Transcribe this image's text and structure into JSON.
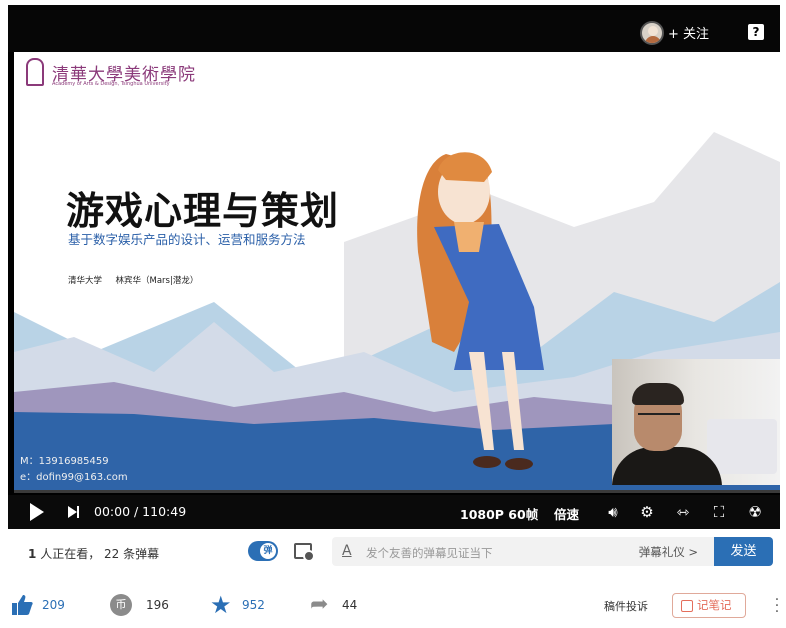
{
  "header": {
    "follow_label": "+ 关注",
    "help_label": "?"
  },
  "slide": {
    "logo_text": "清華大學美術學院",
    "logo_sub": "Academy of Arts & Design, Tsinghua University",
    "title": "游戏心理与策划",
    "subtitle": "基于数字娱乐产品的设计、运营和服务方法",
    "authors": "清华大学     林宾华（Mars|潜龙）",
    "contact_phone": "M：13916985459",
    "contact_email": "e：dofin99@163.com"
  },
  "controls": {
    "time": "00:00 / 110:49",
    "quality": "1080P 60帧",
    "speed": "倍速"
  },
  "danmaku": {
    "viewers_count": "1",
    "viewers_text": "人正在看，",
    "danmaku_count": "22",
    "danmaku_text": "条弹幕",
    "toggle_label": "弹",
    "placeholder": "发个友善的弹幕见证当下",
    "etiquette": "弹幕礼仪 >",
    "send_label": "发送"
  },
  "actions": {
    "likes": "209",
    "coins": "196",
    "coin_glyph": "币",
    "favorites": "952",
    "shares": "44",
    "report_label": "稿件投诉",
    "note_label": "记笔记"
  },
  "colors": {
    "accent": "#2b6fb5",
    "note": "#e46e5c"
  }
}
